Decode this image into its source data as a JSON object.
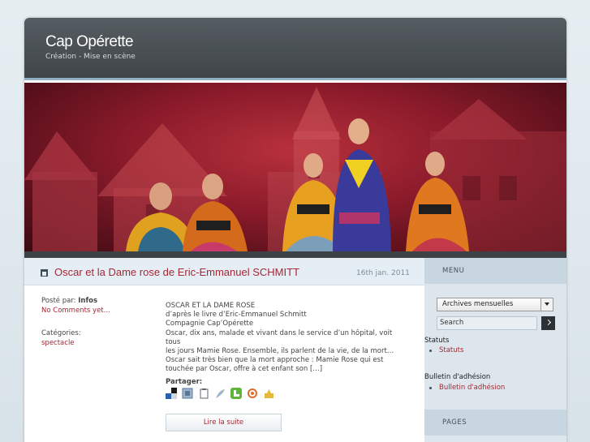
{
  "site": {
    "title": "Cap Opérette",
    "description": "Création - Mise en scène"
  },
  "post": {
    "title": "Oscar et la Dame rose de Eric-Emmanuel SCHMITT",
    "date": "16th jan. 2011",
    "posted_by_label": "Posté par:",
    "posted_by_value": "Infos",
    "comments": "No Comments yet...",
    "categories_label": "Catégories:",
    "category": "spectacle",
    "excerpt_lines": [
      "OSCAR ET LA DAME ROSE",
      "d’après le livre d’Eric-Emmanuel Schmitt",
      "Compagnie Cap’Opérette",
      "Oscar, dix ans, malade et vivant dans le service d’un hôpital, voit tous",
      "les jours Mamie Rose. Ensemble, ils parlent de la vie, de la mort…",
      "Oscar sait très bien que la mort approche : Mamie Rose qui est",
      "touchée par Oscar, offre à cet enfant son […]"
    ],
    "share_label": "Partager:",
    "share_icons": [
      "delicious-icon",
      "digg-icon",
      "clipboard-icon",
      "feather-icon",
      "technorati-icon",
      "stumble-icon",
      "bookmark-icon"
    ],
    "read_more": "Lire la suite"
  },
  "sidebar": {
    "menu_heading": "MENU",
    "archives_select": "Archives mensuelles",
    "search_value": "Search",
    "statuts_title": "Statuts",
    "statuts_item": "Statuts",
    "bulletin_title": "Bulletin d'adhésion",
    "bulletin_item": "Bulletin d'adhésion",
    "pages_heading": "PAGES"
  },
  "colors": {
    "header": "#4a5155",
    "accent_link": "#a52834",
    "sidebar_bg": "#dde6ed",
    "post_head_bg": "#e6eef5"
  }
}
